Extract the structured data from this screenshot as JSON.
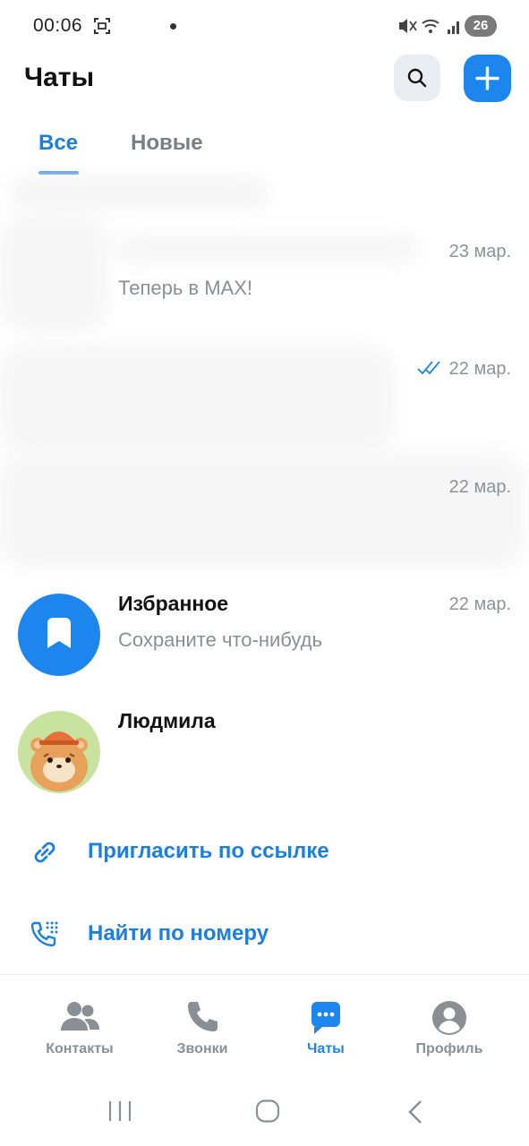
{
  "status_bar": {
    "time": "00:06",
    "battery": "26",
    "icons": [
      "screenshot-icon",
      "mute-icon",
      "wifi-icon",
      "signal-icon",
      "battery-icon"
    ]
  },
  "header": {
    "title": "Чаты",
    "search_icon": "search-icon",
    "add_icon": "plus-icon"
  },
  "tabs": [
    {
      "label": "Все",
      "active": true
    },
    {
      "label": "Новые",
      "active": false
    }
  ],
  "chats": [
    {
      "name": "",
      "preview": "Теперь в MAX!",
      "date": "23 мар.",
      "read": false
    },
    {
      "name": "",
      "preview": "",
      "date": "22 мар.",
      "read": true
    },
    {
      "name": "",
      "preview": "",
      "date": "22 мар.",
      "read": false
    },
    {
      "name": "Избранное",
      "preview": "Сохраните что-нибудь",
      "date": "22 мар.",
      "avatar": "bookmark-icon"
    },
    {
      "name": "Людмила",
      "preview": "",
      "date": "",
      "avatar": "hamster-avatar"
    }
  ],
  "actions": [
    {
      "label": "Пригласить по ссылке",
      "icon": "link-icon"
    },
    {
      "label": "Найти по номеру",
      "icon": "phone-keypad-icon"
    }
  ],
  "bottom_nav": [
    {
      "label": "Контакты",
      "icon": "contacts-icon",
      "active": false
    },
    {
      "label": "Звонки",
      "icon": "phone-icon",
      "active": false
    },
    {
      "label": "Чаты",
      "icon": "chat-icon",
      "active": true
    },
    {
      "label": "Профиль",
      "icon": "profile-icon",
      "active": false
    }
  ],
  "colors": {
    "accent": "#1c86ee",
    "accent_text": "#1c7fe0",
    "muted": "#8a8f96"
  }
}
